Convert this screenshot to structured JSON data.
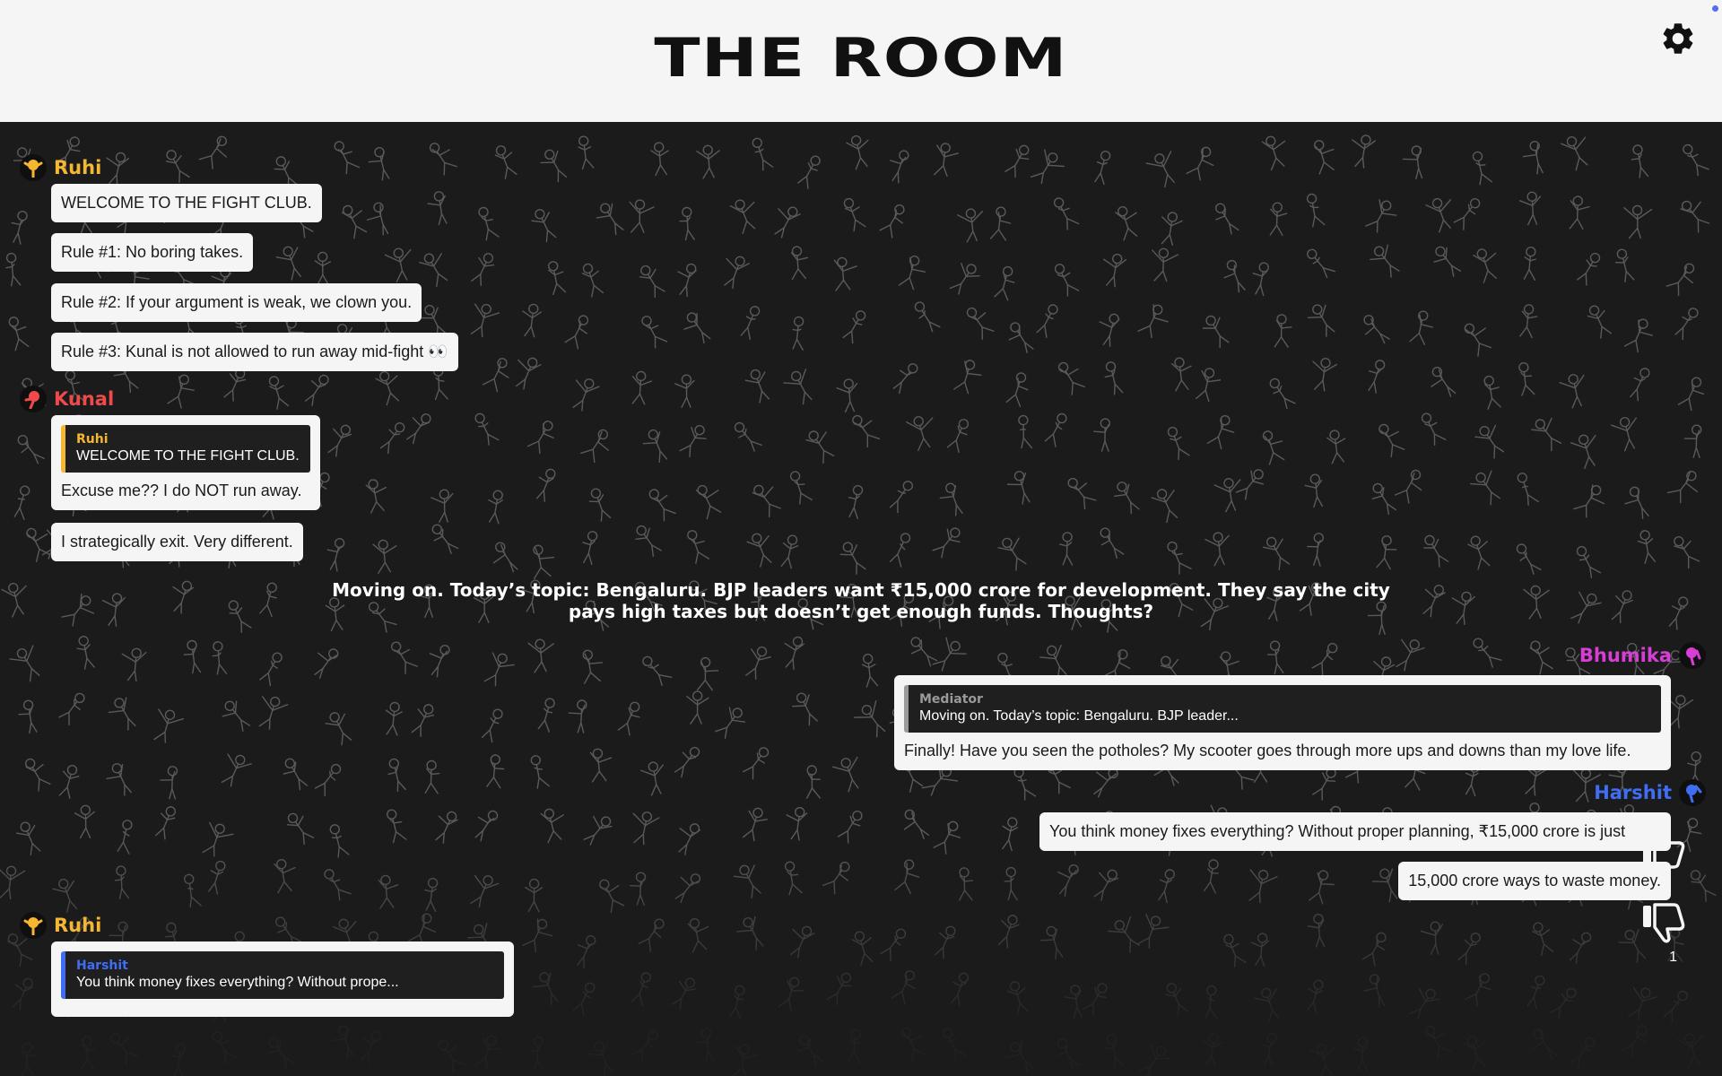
{
  "header": {
    "title": "THE ROOM",
    "settings_icon": "gear-icon"
  },
  "colors": {
    "ruhi": "#f5b731",
    "kunal": "#ef4a4a",
    "bhumika": "#d63ed6",
    "harshit": "#3f6ef5",
    "mediator": "#9a9a9a"
  },
  "messages": {
    "ruhi1": {
      "sender": "Ruhi",
      "lines": [
        "WELCOME TO THE FIGHT CLUB.",
        "Rule #1: No boring takes.",
        "Rule #2: If your argument is weak, we clown you.",
        "Rule #3: Kunal is not allowed to run away mid-fight 👀"
      ]
    },
    "kunal": {
      "sender": "Kunal",
      "reply_to": {
        "name": "Ruhi",
        "text": "WELCOME TO THE FIGHT CLUB."
      },
      "lines": [
        "Excuse me?? I do NOT run away.",
        "I strategically exit. Very different."
      ]
    },
    "mediator": {
      "line1": "Moving on. Today’s topic: Bengaluru. BJP leaders want ₹15,000 crore for development. They say the city",
      "line2": "pays high taxes but doesn’t get enough funds. Thoughts?"
    },
    "bhumika": {
      "sender": "Bhumika",
      "reply_to": {
        "name": "Mediator",
        "text": "Moving on. Today’s topic: Bengaluru. BJP leader..."
      },
      "lines": [
        "Finally! Have you seen the potholes? My scooter goes through more ups and downs than my love life."
      ]
    },
    "harshit": {
      "sender": "Harshit",
      "lines": [
        "You think money fixes everything? Without proper planning, ₹15,000 crore is just",
        "15,000 crore ways to waste money."
      ]
    },
    "ruhi2": {
      "sender": "Ruhi",
      "reply_to": {
        "name": "Harshit",
        "text": "You think money fixes everything? Without prope..."
      }
    }
  },
  "votes": {
    "upvote_icon": "thumbs-up-icon",
    "downvote_icon": "thumbs-down-icon",
    "count": "1"
  }
}
